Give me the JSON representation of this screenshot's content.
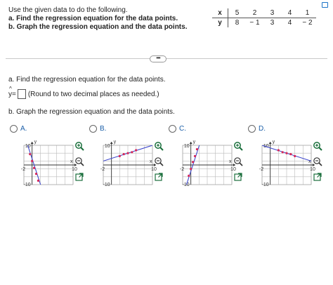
{
  "question": {
    "line1": "Use the given data to do the following.",
    "line2": "a. Find the regression equation for the data points.",
    "line3": "b. Graph the regression equation and the data points."
  },
  "table": {
    "x_label": "x",
    "y_label": "y",
    "x": [
      "5",
      "2",
      "3",
      "4",
      "1"
    ],
    "y": [
      "8",
      "− 1",
      "3",
      "4",
      "− 2"
    ]
  },
  "more_button": "•••",
  "part_a": {
    "label": "a. Find the regression equation for the data points.",
    "y_symbol": "y",
    "hat_symbol": "^",
    "equals": "=",
    "hint": "(Round to two decimal places as needed.)"
  },
  "part_b": {
    "label": "b. Graph the regression equation and the data points."
  },
  "axis": {
    "x_name": "x",
    "y_name": "y",
    "pos_tick": "10",
    "neg_x": "-2",
    "neg_y": "-10"
  },
  "options": [
    {
      "label": "A.",
      "line": [
        [
          -2,
          16
        ],
        [
          3,
          -16
        ]
      ],
      "points": [
        [
          -0.5,
          5.5
        ],
        [
          0,
          2
        ],
        [
          0.5,
          -1.5
        ],
        [
          1,
          -4.5
        ],
        [
          1.5,
          -8
        ]
      ]
    },
    {
      "label": "B.",
      "line": [
        [
          -2,
          2
        ],
        [
          10,
          10
        ]
      ],
      "points": [
        [
          2,
          4.5
        ],
        [
          3,
          5.5
        ],
        [
          4,
          6
        ],
        [
          5,
          6.5
        ],
        [
          6,
          7.5
        ]
      ]
    },
    {
      "label": "C.",
      "line": [
        [
          -2,
          -16
        ],
        [
          3,
          16
        ]
      ],
      "points": [
        [
          -0.5,
          -5.5
        ],
        [
          0,
          -2
        ],
        [
          0.5,
          1.5
        ],
        [
          1,
          4.5
        ],
        [
          1.5,
          8
        ]
      ]
    },
    {
      "label": "D.",
      "line": [
        [
          -2,
          10
        ],
        [
          10,
          2
        ]
      ],
      "points": [
        [
          2,
          7.5
        ],
        [
          3,
          6.5
        ],
        [
          4,
          6
        ],
        [
          5,
          5.5
        ],
        [
          6,
          4.5
        ]
      ]
    }
  ],
  "colors": {
    "line": "#3f48cc",
    "point": "#d6285a",
    "link": "#1a5ea8",
    "tool": "#1a6f3c"
  },
  "icons": {
    "zoom_in": "zoom-in-icon",
    "zoom_out": "zoom-out-icon",
    "popout": "popout-icon"
  }
}
